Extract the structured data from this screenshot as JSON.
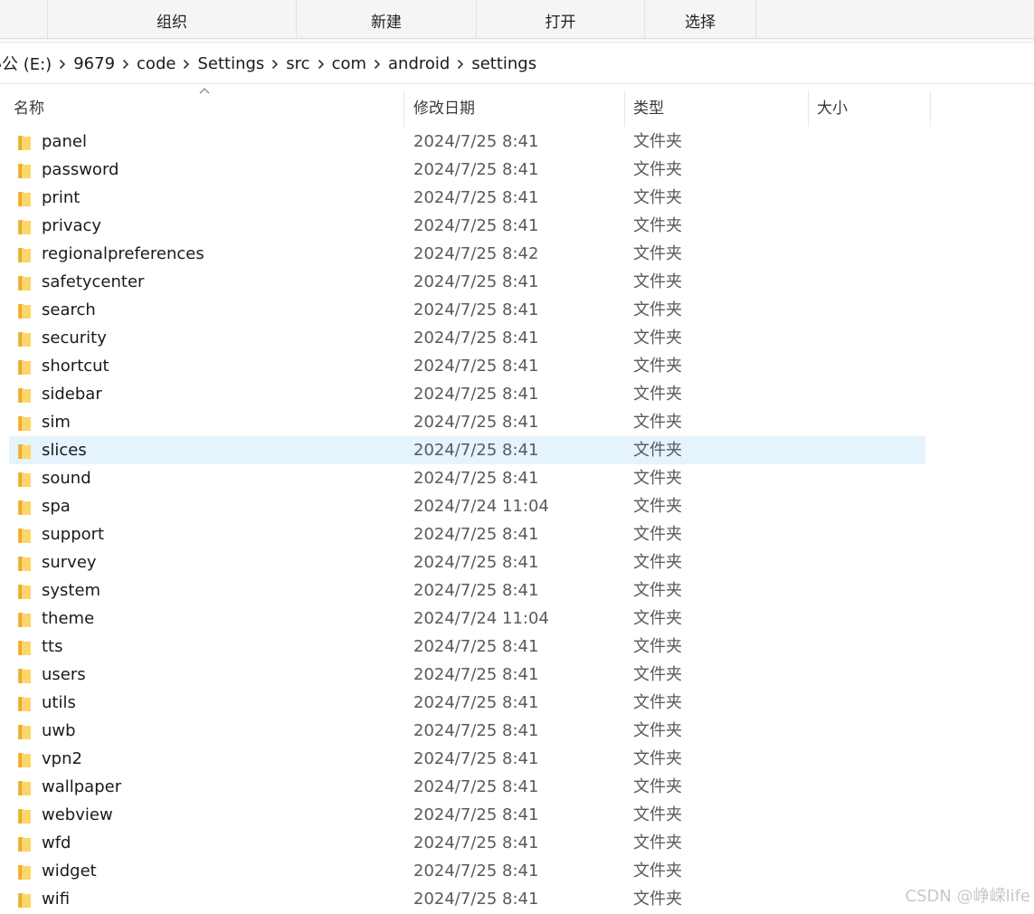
{
  "ribbon": {
    "tabs": [
      {
        "label": "组织"
      },
      {
        "label": "新建"
      },
      {
        "label": "打开"
      },
      {
        "label": "选择"
      }
    ]
  },
  "breadcrumb": {
    "segments": [
      "办公 (E:)",
      "9679",
      "code",
      "Settings",
      "src",
      "com",
      "android",
      "settings"
    ]
  },
  "columns": {
    "name": "名称",
    "modified": "修改日期",
    "type": "类型",
    "size": "大小",
    "sort": "ascending by name"
  },
  "selected_item": "slices",
  "files": [
    {
      "name": "panel",
      "modified": "2024/7/25 8:41",
      "type": "文件夹"
    },
    {
      "name": "password",
      "modified": "2024/7/25 8:41",
      "type": "文件夹"
    },
    {
      "name": "print",
      "modified": "2024/7/25 8:41",
      "type": "文件夹"
    },
    {
      "name": "privacy",
      "modified": "2024/7/25 8:41",
      "type": "文件夹"
    },
    {
      "name": "regionalpreferences",
      "modified": "2024/7/25 8:42",
      "type": "文件夹"
    },
    {
      "name": "safetycenter",
      "modified": "2024/7/25 8:41",
      "type": "文件夹"
    },
    {
      "name": "search",
      "modified": "2024/7/25 8:41",
      "type": "文件夹"
    },
    {
      "name": "security",
      "modified": "2024/7/25 8:41",
      "type": "文件夹"
    },
    {
      "name": "shortcut",
      "modified": "2024/7/25 8:41",
      "type": "文件夹"
    },
    {
      "name": "sidebar",
      "modified": "2024/7/25 8:41",
      "type": "文件夹"
    },
    {
      "name": "sim",
      "modified": "2024/7/25 8:41",
      "type": "文件夹"
    },
    {
      "name": "slices",
      "modified": "2024/7/25 8:41",
      "type": "文件夹"
    },
    {
      "name": "sound",
      "modified": "2024/7/25 8:41",
      "type": "文件夹"
    },
    {
      "name": "spa",
      "modified": "2024/7/24 11:04",
      "type": "文件夹"
    },
    {
      "name": "support",
      "modified": "2024/7/25 8:41",
      "type": "文件夹"
    },
    {
      "name": "survey",
      "modified": "2024/7/25 8:41",
      "type": "文件夹"
    },
    {
      "name": "system",
      "modified": "2024/7/25 8:41",
      "type": "文件夹"
    },
    {
      "name": "theme",
      "modified": "2024/7/24 11:04",
      "type": "文件夹"
    },
    {
      "name": "tts",
      "modified": "2024/7/25 8:41",
      "type": "文件夹"
    },
    {
      "name": "users",
      "modified": "2024/7/25 8:41",
      "type": "文件夹"
    },
    {
      "name": "utils",
      "modified": "2024/7/25 8:41",
      "type": "文件夹"
    },
    {
      "name": "uwb",
      "modified": "2024/7/25 8:41",
      "type": "文件夹"
    },
    {
      "name": "vpn2",
      "modified": "2024/7/25 8:41",
      "type": "文件夹"
    },
    {
      "name": "wallpaper",
      "modified": "2024/7/25 8:41",
      "type": "文件夹"
    },
    {
      "name": "webview",
      "modified": "2024/7/25 8:41",
      "type": "文件夹"
    },
    {
      "name": "wfd",
      "modified": "2024/7/25 8:41",
      "type": "文件夹"
    },
    {
      "name": "widget",
      "modified": "2024/7/25 8:41",
      "type": "文件夹"
    },
    {
      "name": "wifi",
      "modified": "2024/7/25 8:41",
      "type": "文件夹"
    }
  ],
  "watermark": "CSDN @峥嵘life",
  "colors": {
    "selection": "#e5f3fd",
    "folder": "#f8c94a",
    "ribbon_bg": "#f5f5f5"
  },
  "icons": {
    "folder": "folder-icon",
    "separator": "chevron-right-icon",
    "sort": "sort-ascending-icon"
  }
}
